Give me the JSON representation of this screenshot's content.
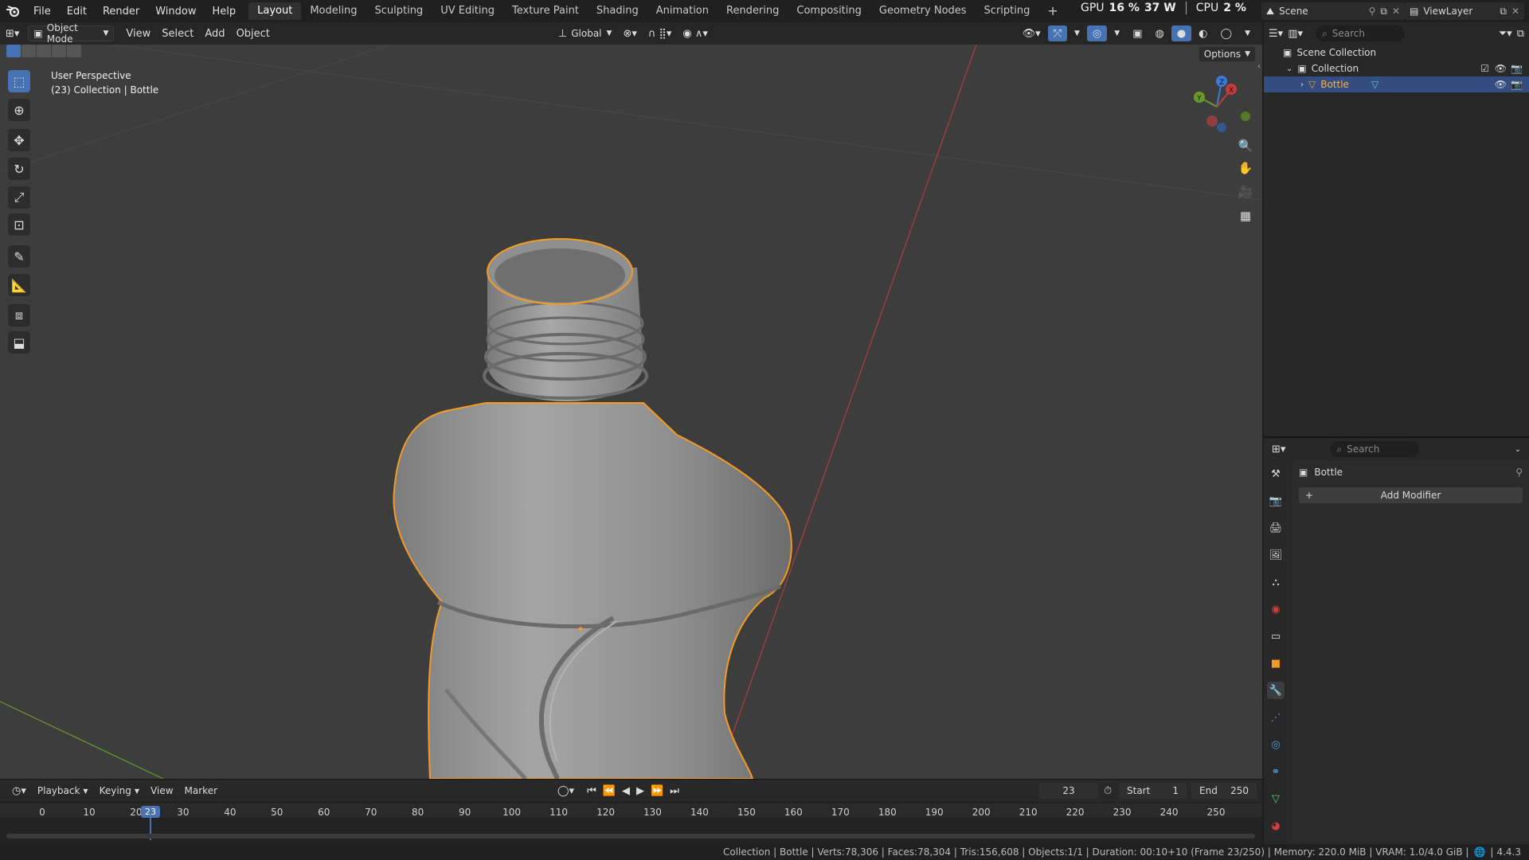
{
  "app": {
    "logo_icon": "blender-logo-icon"
  },
  "menus": [
    "File",
    "Edit",
    "Render",
    "Window",
    "Help"
  ],
  "workspaces": [
    {
      "label": "Layout",
      "active": true
    },
    {
      "label": "Modeling"
    },
    {
      "label": "Sculpting"
    },
    {
      "label": "UV Editing"
    },
    {
      "label": "Texture Paint"
    },
    {
      "label": "Shading"
    },
    {
      "label": "Animation"
    },
    {
      "label": "Rendering"
    },
    {
      "label": "Compositing"
    },
    {
      "label": "Geometry Nodes"
    },
    {
      "label": "Scripting"
    }
  ],
  "add_workspace": "+",
  "perf": {
    "gpu_label": "GPU",
    "gpu_value": "16 %",
    "gpu_power": "37 W",
    "cpu_label": "CPU",
    "cpu_value": "2 %"
  },
  "scene": {
    "name": "Scene",
    "view_layer": "ViewLayer"
  },
  "viewport_header": {
    "mode": "Object Mode",
    "view": "View",
    "select": "Select",
    "add": "Add",
    "object": "Object",
    "orientation": "Global",
    "options": "Options"
  },
  "viewport": {
    "perspective_label": "User Perspective",
    "collection_label": "(23) Collection | Bottle",
    "gizmo": {
      "x": "X",
      "y": "Y",
      "z": "Z"
    },
    "colors": {
      "background": "#3d3d3d",
      "selection": "#f59a23",
      "x_axis": "#c43c3c",
      "y_axis": "#6a9a29",
      "accent": "#4772b3"
    }
  },
  "tools": [
    "select-box-icon",
    "cursor-icon",
    "move-icon",
    "rotate-icon",
    "scale-icon",
    "transform-icon",
    "annotate-icon",
    "measure-icon",
    "add-cube-icon",
    "extrude-icon"
  ],
  "timeline": {
    "menus": [
      "Playback",
      "Keying",
      "View",
      "Marker"
    ],
    "current_frame": "23",
    "start_label": "Start",
    "start": "1",
    "end_label": "End",
    "end": "250",
    "ticks": [
      "0",
      "10",
      "20",
      "30",
      "40",
      "50",
      "60",
      "70",
      "80",
      "90",
      "100",
      "110",
      "120",
      "130",
      "140",
      "150",
      "160",
      "170",
      "180",
      "190",
      "200",
      "210",
      "220",
      "230",
      "240",
      "250"
    ]
  },
  "outliner": {
    "search_placeholder": "Search",
    "scene_collection": "Scene Collection",
    "collection": "Collection",
    "object": "Bottle"
  },
  "properties": {
    "search_placeholder": "Search",
    "object_name": "Bottle",
    "add_modifier": "Add Modifier"
  },
  "status": "Collection | Bottle | Verts:78,306 | Faces:78,304 | Tris:156,608 | Objects:1/1 | Duration: 00:10+10 (Frame 23/250) | Memory: 220.0 MiB | VRAM: 1.0/4.0 GiB |",
  "version": "4.4.3"
}
